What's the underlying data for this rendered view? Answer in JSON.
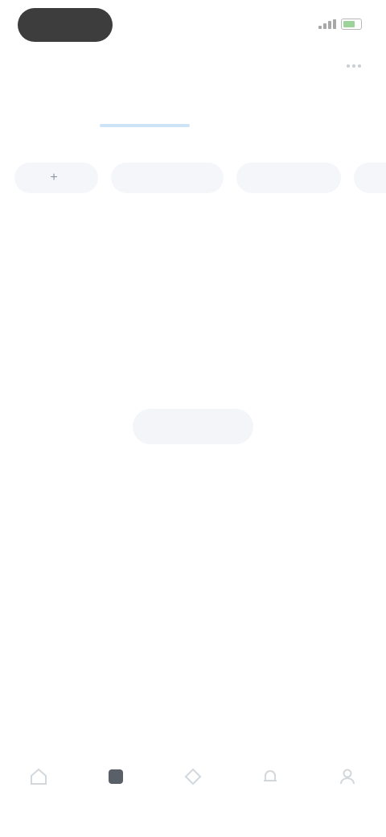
{
  "status_bar": {
    "time": "",
    "colors": {
      "pill": "#3d3d3d",
      "battery": "#9bd39b"
    }
  },
  "header": {
    "action_icon": "more-icon"
  },
  "tabs": [
    {
      "label": "",
      "active": false
    },
    {
      "label": "",
      "active": true
    },
    {
      "label": "",
      "active": false
    }
  ],
  "chips": [
    {
      "label": "",
      "icon": "plus-icon"
    },
    {
      "label": ""
    },
    {
      "label": ""
    },
    {
      "label": ""
    }
  ],
  "section": {
    "title": "",
    "meta": ""
  },
  "empty_state": {
    "title": "",
    "description": "",
    "button_label": ""
  },
  "bottom_nav": [
    {
      "label": "",
      "icon": "home-icon",
      "active": false
    },
    {
      "label": "",
      "icon": "square-icon",
      "active": true
    },
    {
      "label": "",
      "icon": "diamond-icon",
      "active": false
    },
    {
      "label": "",
      "icon": "bell-icon",
      "active": false
    },
    {
      "label": "",
      "icon": "profile-icon",
      "active": false
    }
  ],
  "colors": {
    "tab_active_underline": "#cfe3f7",
    "chip_background": "#f4f6f9",
    "accent_text": "#3b4a5c"
  }
}
